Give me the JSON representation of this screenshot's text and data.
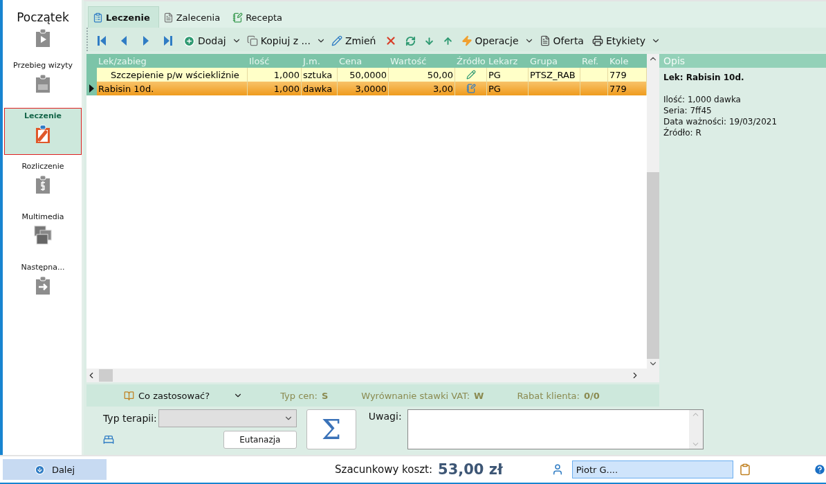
{
  "sidebar": {
    "items": [
      {
        "label": "Początek",
        "kind": "play",
        "selected": false
      },
      {
        "label": "Przebieg wizyty",
        "kind": "list",
        "selected": false
      },
      {
        "label": "Leczenie",
        "kind": "pill",
        "selected": true
      },
      {
        "label": "Rozliczenie",
        "kind": "dollar",
        "selected": false
      },
      {
        "label": "Multimedia",
        "kind": "media",
        "selected": false
      },
      {
        "label": "Następna...",
        "kind": "next",
        "selected": false
      }
    ]
  },
  "tabs": [
    {
      "label": "Leczenie",
      "selected": true
    },
    {
      "label": "Zalecenia",
      "selected": false
    },
    {
      "label": "Recepta",
      "selected": false
    }
  ],
  "toolbar": [
    {
      "kind": "first"
    },
    {
      "kind": "prev"
    },
    {
      "kind": "next"
    },
    {
      "kind": "last"
    },
    {
      "kind": "add",
      "label": "Dodaj",
      "dropdown": true
    },
    {
      "kind": "copy",
      "label": "Kopiuj z ...",
      "dropdown": true
    },
    {
      "kind": "edit",
      "label": "Zmień",
      "dropdown": false
    },
    {
      "kind": "delete"
    },
    {
      "kind": "refresh"
    },
    {
      "kind": "down"
    },
    {
      "kind": "up"
    },
    {
      "kind": "bolt",
      "label": "Operacje",
      "dropdown": true
    },
    {
      "kind": "offer",
      "label": "Oferta",
      "dropdown": false
    },
    {
      "kind": "printer",
      "label": "Etykiety",
      "dropdown": true
    }
  ],
  "table": {
    "columns": [
      "Lek/zabieg",
      "Ilość",
      "J.m.",
      "Cena",
      "Wartość",
      "Źródło",
      "Lekarz",
      "Grupa",
      "Ref.",
      "Kole"
    ],
    "rows": [
      {
        "kind": "service",
        "selected": false,
        "cells": [
          "Szczepienie p/w wściekliźnie",
          "1,000",
          "sztuka",
          "50,0000",
          "50,00",
          "",
          "PG",
          "PTSZ_RAB",
          "",
          "779"
        ]
      },
      {
        "kind": "drug",
        "selected": true,
        "cells": [
          "Rabisin 10d.",
          "1,000",
          "dawka",
          "3,0000",
          "3,00",
          "",
          "PG",
          "",
          "",
          "779"
        ]
      }
    ]
  },
  "description": {
    "title": "Opis",
    "heading": "Lek: Rabisin 10d.",
    "lines": [
      "Ilość: 1,000 dawka",
      "Seria: 7ff45",
      "Data ważności: 19/03/2021",
      "Źródło: R"
    ]
  },
  "filter_bar": {
    "what_to_use": "Co zastosować?",
    "fields": [
      {
        "label": "Typ cen:",
        "value": "S"
      },
      {
        "label": "Wyrównanie stawki VAT:",
        "value": "W"
      },
      {
        "label": "Rabat klienta:",
        "value": "0/0"
      }
    ]
  },
  "form": {
    "therapy_label": "Typ terapii:",
    "euthanasia_button": "Eutanazja",
    "sum_button": "Σ",
    "notes_label": "Uwagi:"
  },
  "footer": {
    "next_button": "Dalej",
    "cost_label": "Szacunkowy koszt:",
    "cost_value": "53,00 zł",
    "doctor": "Piotr G...."
  }
}
